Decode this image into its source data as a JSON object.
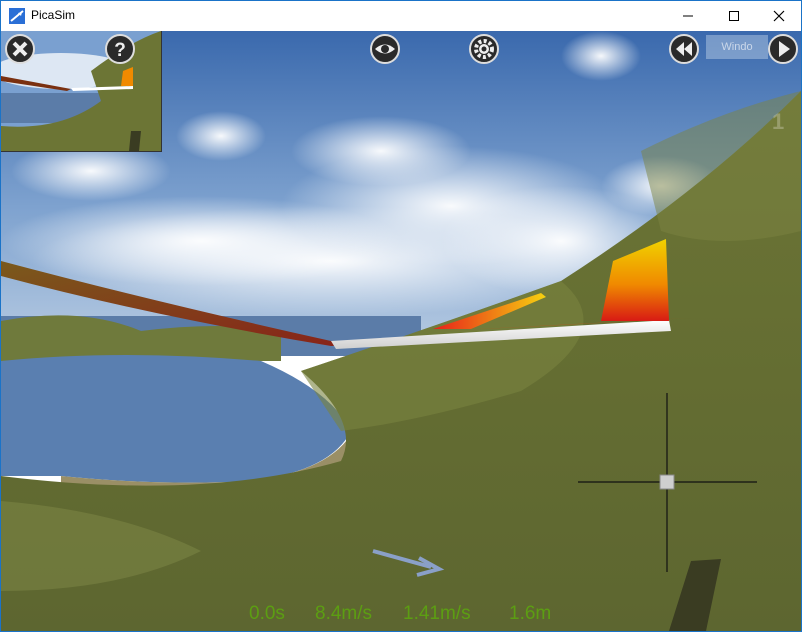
{
  "window": {
    "title": "PicaSim",
    "app_icon": "picasim-app-icon",
    "controls": {
      "minimize": "minimize-icon",
      "maximize": "maximize-icon",
      "close": "close-icon"
    }
  },
  "toolbar": {
    "left": [
      {
        "name": "quit-button",
        "icon": "close-icon"
      },
      {
        "name": "help-button",
        "icon": "question-icon"
      }
    ],
    "center": [
      {
        "name": "view-button",
        "icon": "eye-icon"
      },
      {
        "name": "settings-button",
        "icon": "gear-icon"
      }
    ],
    "right": [
      {
        "name": "rewind-button",
        "icon": "rewind-icon"
      },
      {
        "name": "play-button",
        "icon": "play-icon"
      }
    ]
  },
  "ghost_window_label": "Windo",
  "ghost_counter": "1",
  "hud": {
    "time": "0.0s",
    "airspeed": "8.4m/s",
    "vertical_speed": "1.41m/s",
    "altitude": "1.6m"
  },
  "colors": {
    "sky_top": "#3d6db0",
    "sky_bottom": "#a9c2de",
    "hill": "#6b7434",
    "water": "#5a7fb0",
    "hud_text": "#5c9e12",
    "tail_top": "#f0d000",
    "tail_bottom": "#e02010"
  }
}
